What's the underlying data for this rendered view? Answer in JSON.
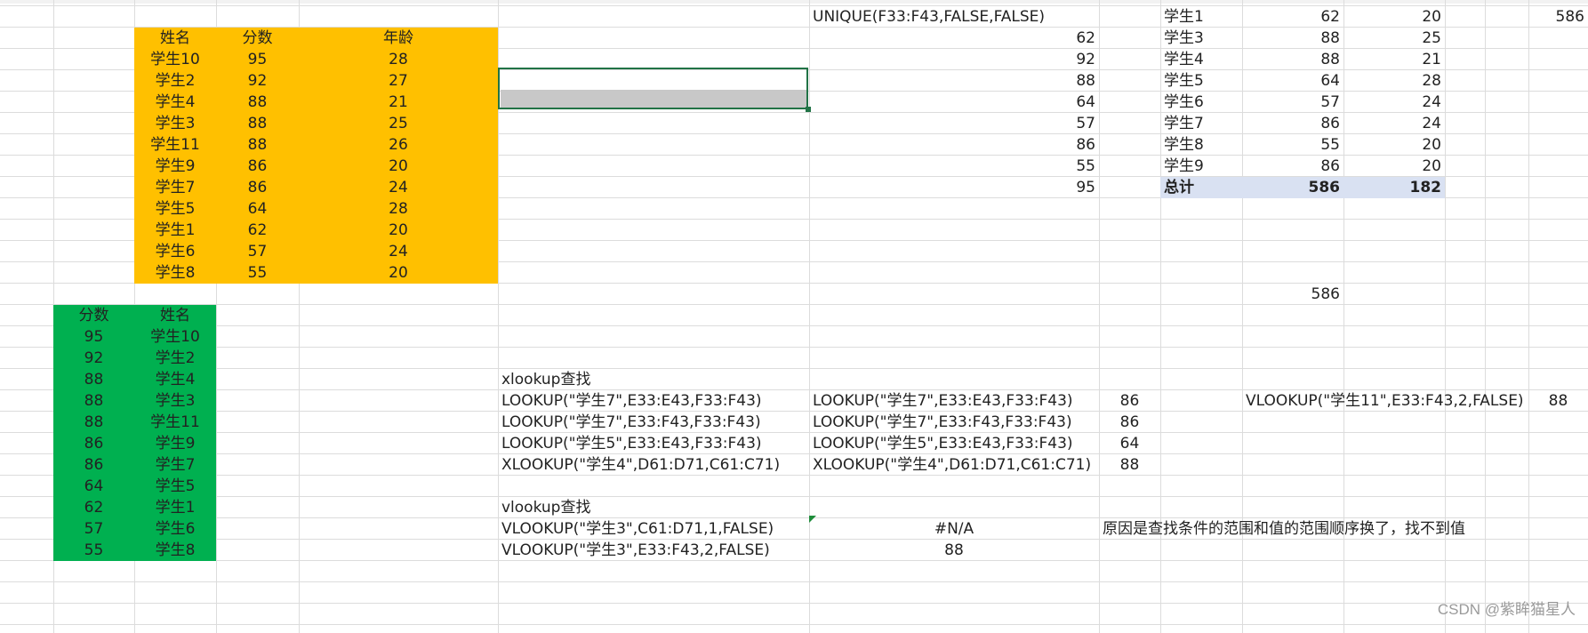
{
  "colors": {
    "orange": "#FFC000",
    "green": "#00B050",
    "pivot_total_bg": "#D9E1F2",
    "selection": "#217346",
    "grid": "#DCDCDC"
  },
  "orange_table": {
    "headers": [
      "姓名",
      "分数",
      "年龄"
    ],
    "rows": [
      [
        "学生10",
        "95",
        "28"
      ],
      [
        "学生2",
        "92",
        "27"
      ],
      [
        "学生4",
        "88",
        "21"
      ],
      [
        "学生3",
        "88",
        "25"
      ],
      [
        "学生11",
        "88",
        "26"
      ],
      [
        "学生9",
        "86",
        "20"
      ],
      [
        "学生7",
        "86",
        "24"
      ],
      [
        "学生5",
        "64",
        "28"
      ],
      [
        "学生1",
        "62",
        "20"
      ],
      [
        "学生6",
        "57",
        "24"
      ],
      [
        "学生8",
        "55",
        "20"
      ]
    ]
  },
  "green_table": {
    "headers": [
      "分数",
      "姓名"
    ],
    "rows": [
      [
        "95",
        "学生10"
      ],
      [
        "92",
        "学生2"
      ],
      [
        "88",
        "学生4"
      ],
      [
        "88",
        "学生3"
      ],
      [
        "88",
        "学生11"
      ],
      [
        "86",
        "学生9"
      ],
      [
        "86",
        "学生7"
      ],
      [
        "64",
        "学生5"
      ],
      [
        "62",
        "学生1"
      ],
      [
        "57",
        "学生6"
      ],
      [
        "55",
        "学生8"
      ]
    ]
  },
  "unique_block": {
    "formula": "UNIQUE(F33:F43,FALSE,FALSE)",
    "values": [
      "62",
      "92",
      "88",
      "64",
      "57",
      "86",
      "55",
      "95"
    ]
  },
  "pivot": {
    "rows": [
      [
        "学生1",
        "62",
        "20"
      ],
      [
        "学生3",
        "88",
        "25"
      ],
      [
        "学生4",
        "88",
        "21"
      ],
      [
        "学生5",
        "64",
        "28"
      ],
      [
        "学生6",
        "57",
        "24"
      ],
      [
        "学生7",
        "86",
        "24"
      ],
      [
        "学生8",
        "55",
        "20"
      ],
      [
        "学生9",
        "86",
        "20"
      ]
    ],
    "total": [
      "总计",
      "586",
      "182"
    ]
  },
  "corner_value": "586",
  "lone_value": "586",
  "lookup_section": {
    "title": "xlookup查找",
    "rows": [
      {
        "formula": "LOOKUP(\"学生7\",E33:E43,F33:F43)",
        "formula2": "LOOKUP(\"学生7\",E33:E43,F33:F43)",
        "result": "86"
      },
      {
        "formula": "LOOKUP(\"学生7\",E33:F43,F33:F43)",
        "formula2": "LOOKUP(\"学生7\",E33:F43,F33:F43)",
        "result": "86"
      },
      {
        "formula": "LOOKUP(\"学生5\",E33:E43,F33:F43)",
        "formula2": "LOOKUP(\"学生5\",E33:E43,F33:F43)",
        "result": "64"
      },
      {
        "formula": "XLOOKUP(\"学生4\",D61:D71,C61:C71)",
        "formula2": "XLOOKUP(\"学生4\",D61:D71,C61:C71)",
        "result": "88"
      }
    ],
    "side_formula": "VLOOKUP(\"学生11\",E33:F43,2,FALSE)",
    "side_result": "88"
  },
  "vlookup_section": {
    "title": "vlookup查找",
    "rows": [
      {
        "formula": "VLOOKUP(\"学生3\",C61:D71,1,FALSE)",
        "result": "#N/A"
      },
      {
        "formula": "VLOOKUP(\"学生3\",E33:F43,2,FALSE)",
        "result": "88"
      }
    ],
    "note": "原因是查找条件的范围和值的范围顺序换了，找不到值"
  },
  "watermark": "CSDN @紫眸猫星人"
}
